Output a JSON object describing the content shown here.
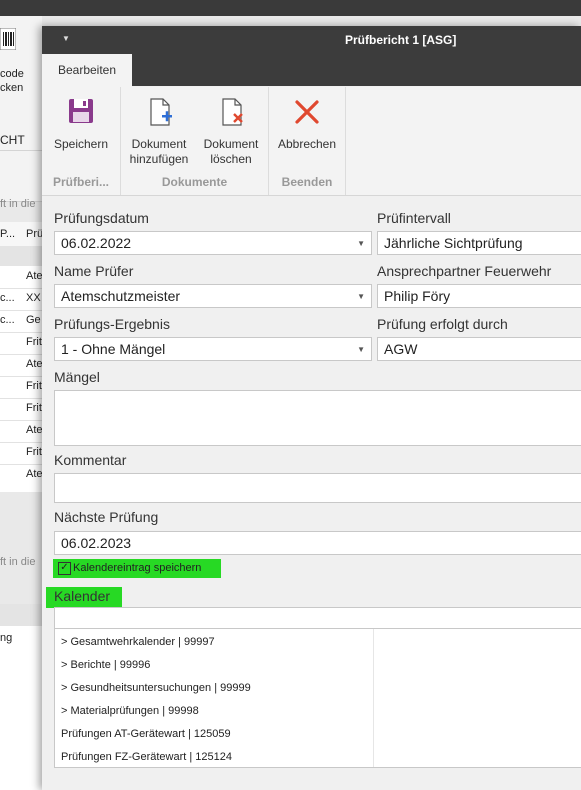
{
  "background_app": {
    "ribbon_text_1": "code",
    "ribbon_text_2": "cken",
    "header_text": "CHT",
    "search_text_1": "ft in die",
    "grid_col_1": "P...",
    "grid_col_2": "Prü",
    "grid_rows": [
      {
        "c1": "",
        "c2": ""
      },
      {
        "c1": "",
        "c2": "Ate"
      },
      {
        "c1": "c...",
        "c2": "XX"
      },
      {
        "c1": "c...",
        "c2": "Ge"
      },
      {
        "c1": "",
        "c2": "Frit"
      },
      {
        "c1": "",
        "c2": "Ate"
      },
      {
        "c1": "",
        "c2": "Frit"
      },
      {
        "c1": "",
        "c2": "Frit"
      },
      {
        "c1": "",
        "c2": "Ate"
      },
      {
        "c1": "",
        "c2": "Frit"
      },
      {
        "c1": "",
        "c2": "Ate"
      }
    ],
    "search_text_2": "ft in die",
    "bottom_text": "ng"
  },
  "dialog": {
    "title": "Prüfbericht 1 [ASG]",
    "tab": "Bearbeiten",
    "ribbon": {
      "groups": [
        {
          "label": "Prüfberi...",
          "buttons": [
            {
              "label": "Speichern",
              "icon": "save-icon"
            }
          ]
        },
        {
          "label": "Dokumente",
          "buttons": [
            {
              "label_1": "Dokument",
              "label_2": "hinzufügen",
              "icon": "document-add-icon"
            },
            {
              "label_1": "Dokument",
              "label_2": "löschen",
              "icon": "document-delete-icon"
            }
          ]
        },
        {
          "label": "Beenden",
          "buttons": [
            {
              "label": "Abbrechen",
              "icon": "close-icon"
            }
          ]
        }
      ]
    },
    "form": {
      "pruefungsdatum_label": "Prüfungsdatum",
      "pruefungsdatum_value": "06.02.2022",
      "pruefintervall_label": "Prüfintervall",
      "pruefintervall_value": "Jährliche Sichtprüfung",
      "name_pruefer_label": "Name Prüfer",
      "name_pruefer_value": "Atemschutzmeister",
      "ansprechpartner_label": "Ansprechpartner Feuerwehr",
      "ansprechpartner_value": "Philip Föry",
      "ergebnis_label": "Prüfungs-Ergebnis",
      "ergebnis_value": "1 - Ohne Mängel",
      "erfolgt_durch_label": "Prüfung erfolgt durch",
      "erfolgt_durch_value": "AGW",
      "maengel_label": "Mängel",
      "maengel_value": "",
      "kommentar_label": "Kommentar",
      "kommentar_value": "",
      "naechste_label": "Nächste Prüfung",
      "naechste_value": "06.02.2023",
      "kalender_checkbox_label": "Kalendereintrag speichern",
      "kalender_checked": true,
      "kalender_label": "Kalender",
      "kalender_value": ""
    },
    "kalender_list": [
      "> Gesamtwehrkalender | 99997",
      "> Berichte | 99996",
      "> Gesundheitsuntersuchungen | 99999",
      "> Materialprüfungen | 99998",
      "Prüfungen AT-Gerätewart | 125059",
      "Prüfungen FZ-Gerätewart | 125124"
    ],
    "colors": {
      "titlebar": "#3c3c3c",
      "highlight": "#27d924",
      "save_icon": "#8a3a8c",
      "delete_icon": "#e0482f"
    }
  }
}
